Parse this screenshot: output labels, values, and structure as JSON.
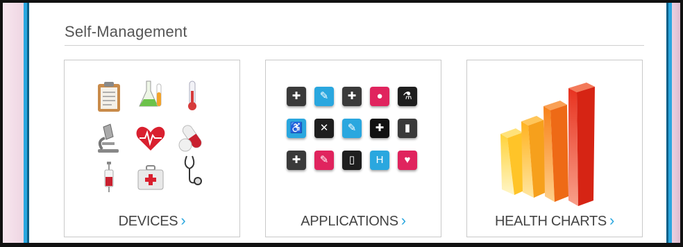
{
  "section": {
    "title": "Self-Management"
  },
  "cards": [
    {
      "label": "DEVICES",
      "chevron": "›"
    },
    {
      "label": "APPLICATIONS",
      "chevron": "›"
    },
    {
      "label": "HEALTH CHARTS",
      "chevron": "›"
    }
  ],
  "device_icons": [
    "clipboard-icon",
    "flask-icon",
    "thermometer-icon",
    "microscope-icon",
    "heart-icon",
    "pill-icon",
    "syringe-icon",
    "first-aid-kit-icon",
    "stethoscope-icon"
  ],
  "app_icons": [
    "pills-icon",
    "syringe-icon",
    "medical-bag-icon",
    "blood-drop-icon",
    "flask-icon",
    "wheelchair-icon",
    "bandage-icon",
    "thermometer-icon",
    "nurse-cap-icon",
    "test-tubes-icon",
    "ambulance-icon",
    "syringe-icon",
    "iv-bottle-icon",
    "hospital-icon",
    "heart-hand-icon"
  ],
  "app_tile_colors": [
    "#3a3a3a",
    "#2aa7df",
    "#3a3a3a",
    "#e0245e",
    "#1e1e1e",
    "#2aa7df",
    "#1e1e1e",
    "#2aa7df",
    "#111111",
    "#3a3a3a",
    "#3a3a3a",
    "#e0245e",
    "#1e1e1e",
    "#2aa7df",
    "#e0245e"
  ],
  "colors": {
    "accent": "#2aa7df",
    "text": "#444444"
  }
}
